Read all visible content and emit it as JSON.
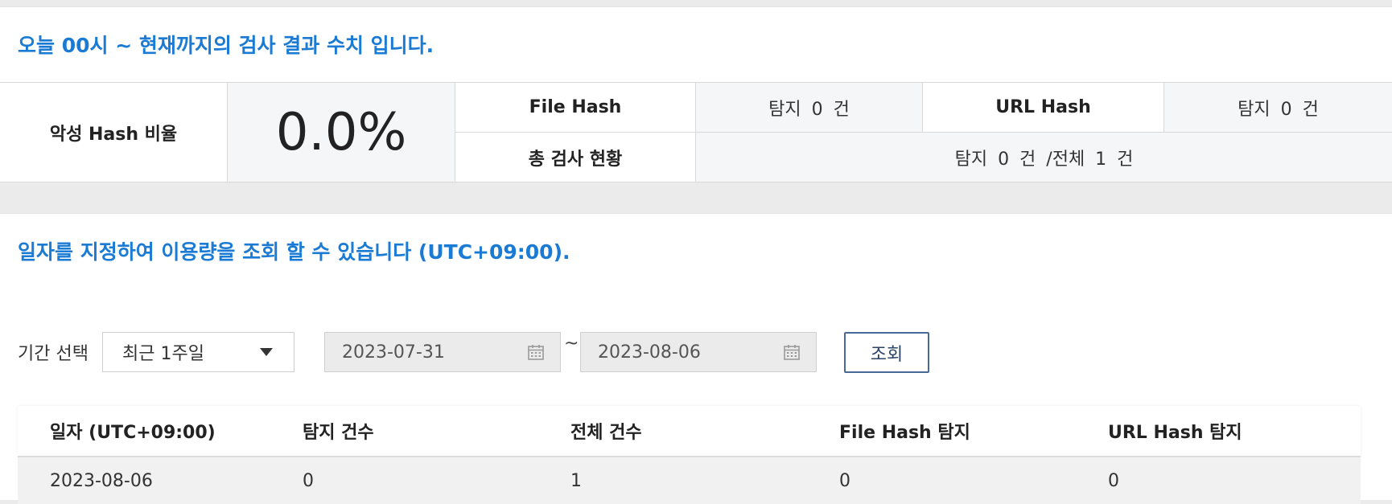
{
  "today_panel": {
    "title": "오늘 00시 ~ 현재까지의 검사 결과 수치 입니다.",
    "malicious_ratio_label": "악성 Hash 비율",
    "malicious_ratio_value": "0.0%",
    "file_hash_label": "File Hash",
    "file_hash_value": "탐지 0 건",
    "url_hash_label": "URL Hash",
    "url_hash_value": "탐지 0 건",
    "total_label": "총 검사 현황",
    "total_value": "탐지 0 건 /전체 1 건"
  },
  "range_panel": {
    "title": "일자를 지정하여 이용량을 조회 할 수 있습니다 (UTC+09:00).",
    "period_label": "기간 선택",
    "period_selected": "최근 1주일",
    "start_date": "2023-07-31",
    "date_separator": "~",
    "end_date": "2023-08-06",
    "search_button": "조회"
  },
  "table": {
    "headers": [
      "일자 (UTC+09:00)",
      "탐지 건수",
      "전체 건수",
      "File Hash 탐지",
      "URL Hash 탐지"
    ],
    "rows": [
      [
        "2023-08-06",
        "0",
        "1",
        "0",
        "0"
      ]
    ]
  },
  "colors": {
    "accent_blue": "#1a7ad4",
    "button_border": "#4a6a96",
    "page_bg": "#ebebeb"
  },
  "icons": [
    "calendar-icon",
    "dropdown-caret-icon"
  ]
}
